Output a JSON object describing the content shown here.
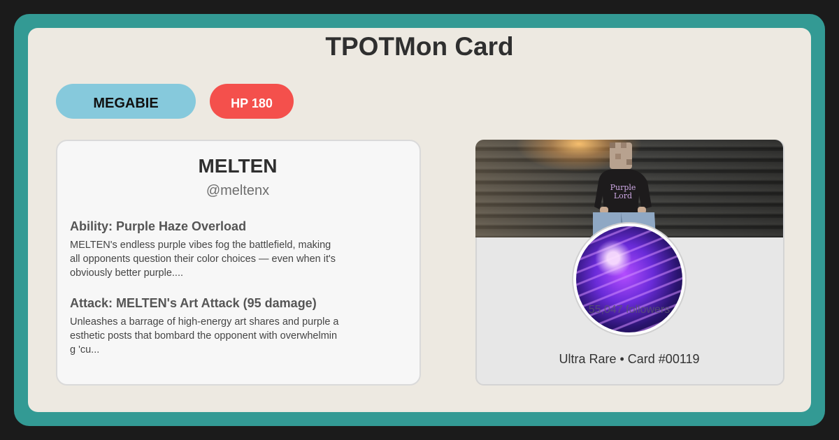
{
  "page": {
    "title": "TPOTMon Card"
  },
  "badges": {
    "type": "MEGABIE",
    "hp": "HP 180"
  },
  "profile": {
    "name": "MELTEN",
    "handle": "@meltenx",
    "ability_title": "Ability: Purple Haze Overload",
    "ability_text": "MELTEN's endless purple vibes fog the battlefield, making all opponents question their color choices — even when it's obviously better purple....",
    "attack_title": "Attack: MELTEN's Art Attack (95 damage)",
    "attack_text": "Unleashes a barrage of high-energy art shares and purple aesthetic posts that bombard the opponent with overwhelming 'cu..."
  },
  "photo": {
    "followers": "55,047 followers",
    "rarity": "Ultra Rare • Card #00119",
    "shirt_text_1": "Purple",
    "shirt_text_2": "Lord"
  },
  "colors": {
    "frame": "#339a94",
    "card_bg": "#ede9e1",
    "type_badge": "#86c9dc",
    "hp_badge": "#f4504c"
  }
}
